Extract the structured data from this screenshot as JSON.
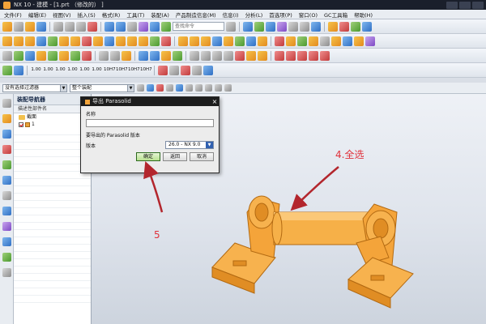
{
  "window": {
    "title": "NX 10 - 建模 - [1.prt （修改的） ]"
  },
  "menu": {
    "items": [
      "文件(F)",
      "编辑(E)",
      "视图(V)",
      "插入(S)",
      "格式(R)",
      "工具(T)",
      "装配(A)",
      "产品制造信息(M)",
      "信息(I)",
      "分析(L)"
    ],
    "right_items": [
      "首选项(P)",
      "窗口(O)",
      "GC工具箱",
      "帮助(H)"
    ]
  },
  "toolbar": {
    "search_placeholder": "查找命令",
    "fit_buttons": [
      "1.00",
      "1.00",
      "1.00",
      "1.00",
      "1.00",
      "1.00",
      "10H7",
      "10H7",
      "10H7",
      "10H7"
    ]
  },
  "filterbar": {
    "selection_filter": "没有选择过滤器",
    "assembly_scope": "整个装配"
  },
  "navigator": {
    "title": "装配导航器",
    "column_header": "描述性部件名",
    "items": [
      {
        "label": "截面"
      },
      {
        "label": "1"
      }
    ]
  },
  "dialog": {
    "title": "导出 Parasolid",
    "name_label": "名称",
    "export_label": "要导出的 Parasolid 版本",
    "version_label": "版本",
    "version_value": "26.0 - NX 9.0",
    "ok_button": "确定",
    "back_button": "返回",
    "cancel_button": "取消"
  },
  "annotations": {
    "select_all": "4.全选",
    "step_number": "5",
    "color": "#e0303a"
  },
  "colors": {
    "model": "#f4a43a",
    "titlebar": "#1a1f2b"
  }
}
